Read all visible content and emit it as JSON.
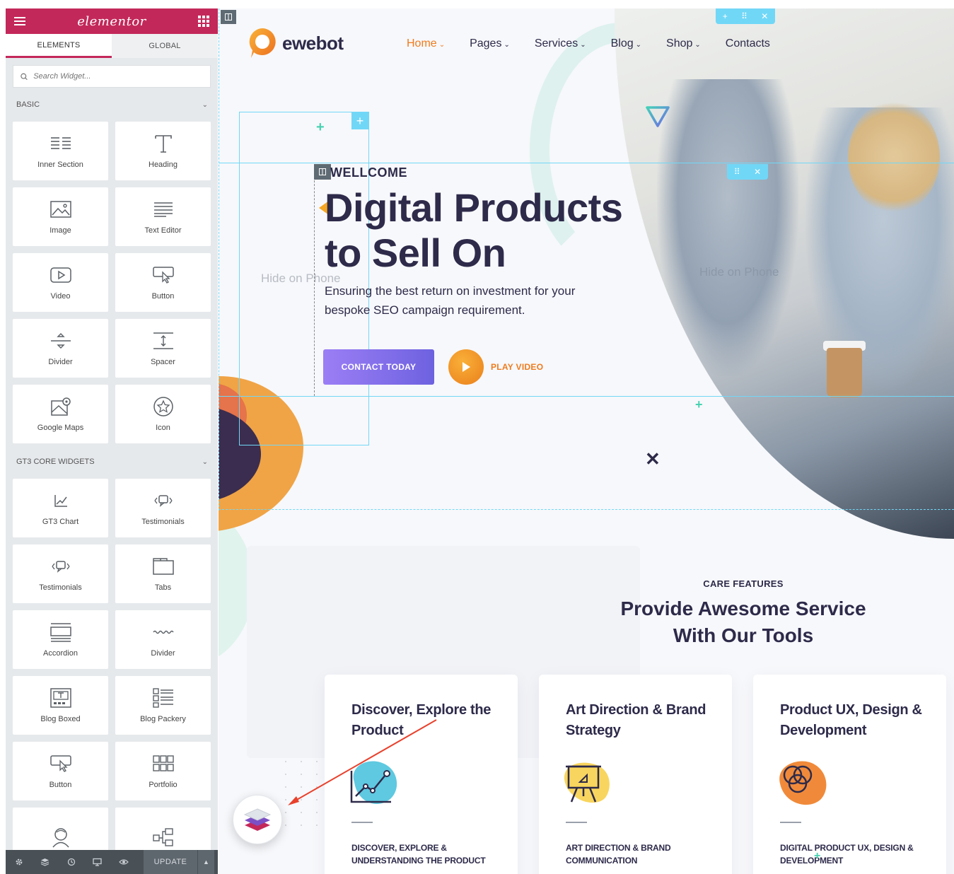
{
  "panel": {
    "brand": "elementor",
    "tabs": [
      "ELEMENTS",
      "GLOBAL"
    ],
    "search_placeholder": "Search Widget...",
    "categories": [
      {
        "title": "BASIC",
        "widgets": [
          {
            "label": "Inner Section",
            "icon": "columns-icon"
          },
          {
            "label": "Heading",
            "icon": "heading-icon"
          },
          {
            "label": "Image",
            "icon": "image-icon"
          },
          {
            "label": "Text Editor",
            "icon": "text-editor-icon"
          },
          {
            "label": "Video",
            "icon": "video-icon"
          },
          {
            "label": "Button",
            "icon": "button-icon"
          },
          {
            "label": "Divider",
            "icon": "divider-icon"
          },
          {
            "label": "Spacer",
            "icon": "spacer-icon"
          },
          {
            "label": "Google Maps",
            "icon": "map-icon"
          },
          {
            "label": "Icon",
            "icon": "star-icon"
          }
        ]
      },
      {
        "title": "GT3 CORE WIDGETS",
        "widgets": [
          {
            "label": "GT3 Chart",
            "icon": "chart-icon"
          },
          {
            "label": "Testimonials",
            "icon": "quote-icon"
          },
          {
            "label": "Testimonials",
            "icon": "quote-icon"
          },
          {
            "label": "Tabs",
            "icon": "tabs-icon"
          },
          {
            "label": "Accordion",
            "icon": "accordion-icon"
          },
          {
            "label": "Divider",
            "icon": "wave-divider-icon"
          },
          {
            "label": "Blog Boxed",
            "icon": "blog-boxed-icon"
          },
          {
            "label": "Blog Packery",
            "icon": "blog-packery-icon"
          },
          {
            "label": "Button",
            "icon": "button-icon"
          },
          {
            "label": "Portfolio",
            "icon": "portfolio-icon"
          },
          {
            "label": "",
            "icon": "team-icon"
          },
          {
            "label": "",
            "icon": "flow-icon"
          }
        ]
      }
    ],
    "footer": {
      "update_label": "UPDATE"
    }
  },
  "site": {
    "brand_name": "ewebot",
    "menu": [
      {
        "label": "Home",
        "has_caret": true,
        "active": true
      },
      {
        "label": "Pages",
        "has_caret": true
      },
      {
        "label": "Services",
        "has_caret": true
      },
      {
        "label": "Blog",
        "has_caret": true
      },
      {
        "label": "Shop",
        "has_caret": true
      },
      {
        "label": "Contacts",
        "has_caret": false
      }
    ],
    "hero": {
      "eyebrow": "WELLCOME",
      "title_line1": "Digital Products",
      "title_line2": "to Sell On",
      "subtitle": "Ensuring the best return on investment for your bespoke SEO campaign requirement.",
      "hide_on_phone": "Hide on Phone",
      "cta_label": "CONTACT TODAY",
      "play_label": "PLAY VIDEO"
    },
    "features": {
      "eyebrow": "CARE FEATURES",
      "title": "Provide Awesome Service With Our Tools",
      "cards": [
        {
          "title": "Discover, Explore the Product",
          "desc": "DISCOVER, EXPLORE & UNDERSTANDING THE PRODUCT",
          "icon": "growth-chart-icon",
          "blob": "#5ec9e0"
        },
        {
          "title": "Art Direction & Brand Strategy",
          "desc": "ART DIRECTION & BRAND COMMUNICATION",
          "icon": "easel-icon",
          "blob": "#f8d55e"
        },
        {
          "title": "Product UX, Design & Development",
          "desc": "DIGITAL PRODUCT UX, DESIGN & DEVELOPMENT",
          "icon": "rings-icon",
          "blob": "#f08a3a"
        }
      ]
    }
  },
  "colors": {
    "elementor_pink": "#c3285a",
    "brand_dark": "#2d2a4a",
    "accent_orange": "#ef7b1e",
    "editor_blue": "#71d7f7",
    "cta_purple": "#7b6ce8"
  }
}
